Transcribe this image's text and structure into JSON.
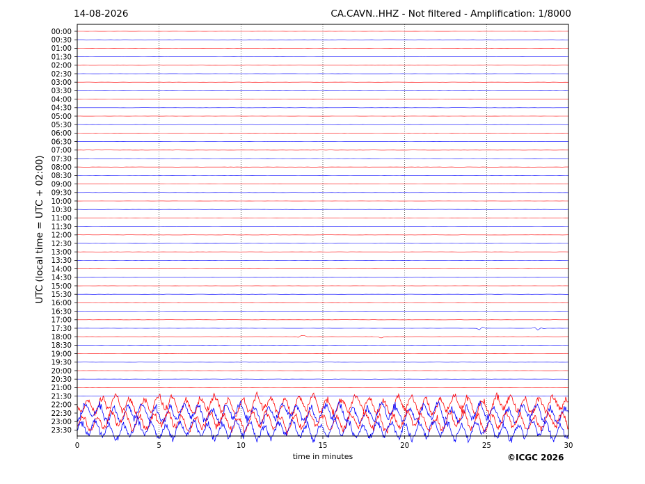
{
  "header": {
    "date": "14-08-2026",
    "title": "CA.CAVN..HHZ - Not filtered - Amplification: 1/8000"
  },
  "footer": {
    "copyright": "©ICGC 2026"
  },
  "chart_data": {
    "type": "line",
    "title": "CA.CAVN..HHZ - Not filtered - Amplification: 1/8000",
    "xlabel": "time in minutes",
    "ylabel": "UTC (local time = UTC + 02:00)",
    "xlim": [
      0,
      30
    ],
    "x_ticks": [
      0,
      5,
      10,
      15,
      20,
      25,
      30
    ],
    "grid": "vertical dotted lines at x = 5, 10, 15, 20, 25",
    "trace_colors": [
      "#ff0000",
      "#0000ff"
    ],
    "rows": [
      "00:00",
      "00:30",
      "01:00",
      "01:30",
      "02:00",
      "02:30",
      "03:00",
      "03:30",
      "04:00",
      "04:30",
      "05:00",
      "05:30",
      "06:00",
      "06:30",
      "07:00",
      "07:30",
      "08:00",
      "08:30",
      "09:00",
      "09:30",
      "10:00",
      "10:30",
      "11:00",
      "11:30",
      "12:00",
      "12:30",
      "13:00",
      "13:30",
      "14:00",
      "14:30",
      "15:00",
      "15:30",
      "16:00",
      "16:30",
      "17:00",
      "17:30",
      "18:00",
      "18:30",
      "19:00",
      "19:30",
      "20:00",
      "20:30",
      "21:00",
      "21:30",
      "22:00",
      "22:30",
      "23:00",
      "23:30"
    ],
    "events": [
      {
        "row": "16:30",
        "description": "intermittent small-amplitude segments"
      },
      {
        "row": "17:00",
        "description": "intermittent small-amplitude segments"
      },
      {
        "row": "17:30",
        "minutes": [
          24.7,
          28.2
        ],
        "description": "small spikes"
      },
      {
        "row": "18:00",
        "minutes": [
          13.7,
          18.4
        ],
        "description": "small spikes"
      },
      {
        "row": "22:00",
        "description": "large-amplitude signal begins, continues to 23:30"
      }
    ]
  }
}
